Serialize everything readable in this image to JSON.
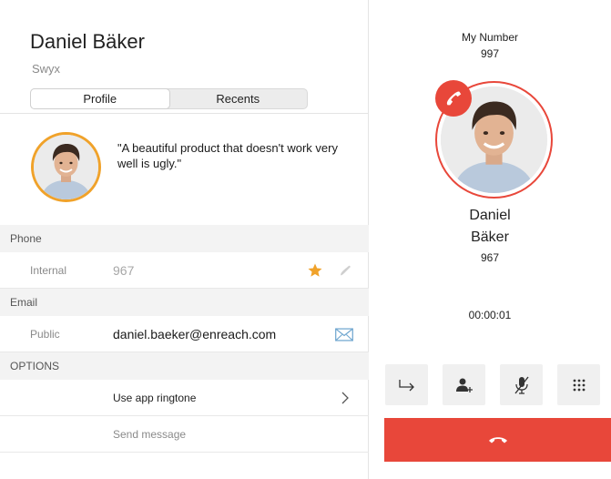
{
  "contact": {
    "name": "Daniel Bäker",
    "company": "Swyx",
    "quote": "\"A beautiful product that doesn't work very well is ugly.\""
  },
  "tabs": [
    {
      "label": "Profile",
      "active": true
    },
    {
      "label": "Recents",
      "active": false
    }
  ],
  "phone": {
    "section_title": "Phone",
    "label": "Internal",
    "value": "967"
  },
  "email": {
    "section_title": "Email",
    "label": "Public",
    "value": "daniel.baeker@enreach.com"
  },
  "options": {
    "section_title": "OPTIONS",
    "items": [
      {
        "label": "Use app ringtone"
      },
      {
        "label": "Send message"
      }
    ]
  },
  "call": {
    "my_number_label": "My Number",
    "my_number": "997",
    "caller_first": "Daniel",
    "caller_last": "Bäker",
    "caller_number": "967",
    "duration": "00:00:01"
  },
  "colors": {
    "accent_red": "#e8473a",
    "avatar_ring": "#f0a22a",
    "favorite_star": "#f0a22a",
    "email_icon": "#6fa6cf"
  },
  "icons": {
    "favorite": "star-icon",
    "call": "phone-icon",
    "email": "envelope-icon",
    "option_chevron": "chevron-right-icon",
    "transfer": "forward-arrow-icon",
    "add_participant": "add-person-icon",
    "mute": "microphone-off-icon",
    "keypad": "dialpad-icon",
    "hangup": "hangup-icon"
  }
}
